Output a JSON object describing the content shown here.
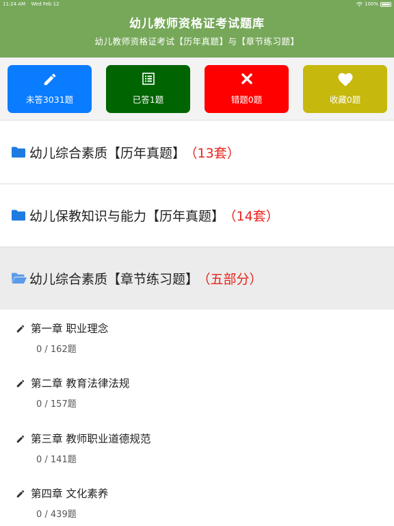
{
  "status_bar": {
    "time": "11:24 AM",
    "date": "Wed Feb 12",
    "battery": "100%"
  },
  "header": {
    "title": "幼儿教师资格证考试题库",
    "subtitle": "幼儿教师资格证考试【历年真题】与【章节练习题】"
  },
  "stats": [
    {
      "label": "未答3031题",
      "icon": "pencil-icon",
      "color": "#0a7cff"
    },
    {
      "label": "已答1题",
      "icon": "list-icon",
      "color": "#006400"
    },
    {
      "label": "错题0题",
      "icon": "close-icon",
      "color": "#ff0000"
    },
    {
      "label": "收藏0题",
      "icon": "heart-icon",
      "color": "#c6b80c"
    }
  ],
  "sections": [
    {
      "title": "幼儿综合素质【历年真题】",
      "count": "（13套）",
      "icon": "folder-icon",
      "expanded": false
    },
    {
      "title": "幼儿保教知识与能力【历年真题】",
      "count": "（14套）",
      "icon": "folder-icon",
      "expanded": false
    },
    {
      "title": "幼儿综合素质【章节练习题】",
      "count": "（五部分）",
      "icon": "folder-open-icon",
      "expanded": true
    }
  ],
  "chapters": [
    {
      "title": "第一章 职业理念",
      "progress": "0 / 162题"
    },
    {
      "title": "第二章 教育法律法规",
      "progress": "0 / 157题"
    },
    {
      "title": "第三章 教师职业道德规范",
      "progress": "0 / 141题"
    },
    {
      "title": "第四章 文化素养",
      "progress": "0 / 439题"
    }
  ],
  "colors": {
    "header_bg": "#77a85a",
    "count_red": "#e8221b",
    "folder_blue": "#1e7be0",
    "folder_open_blue": "#5b9bea"
  }
}
